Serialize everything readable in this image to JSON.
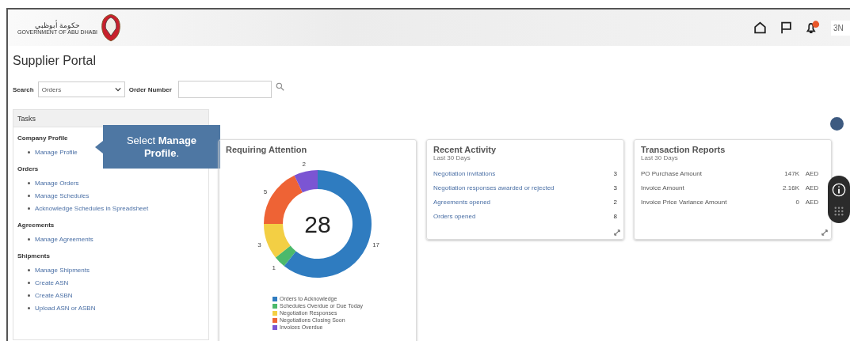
{
  "header": {
    "logo_text_arabic": "حكومة أبوظبي",
    "logo_text": "GOVERNMENT OF ABU DHABI",
    "user_initials": "3N"
  },
  "page_title": "Supplier Portal",
  "search": {
    "label": "Search",
    "value": "Orders",
    "field_label": "Order Number"
  },
  "tasks": {
    "title": "Tasks",
    "groups": [
      {
        "heading": "Company Profile",
        "items": [
          "Manage Profile"
        ]
      },
      {
        "heading": "Orders",
        "items": [
          "Manage Orders",
          "Manage Schedules",
          "Acknowledge Schedules in Spreadsheet"
        ]
      },
      {
        "heading": "Agreements",
        "items": [
          "Manage Agreements"
        ]
      },
      {
        "heading": "Shipments",
        "items": [
          "Manage Shipments",
          "Create ASN",
          "Create ASBN",
          "Upload ASN or ASBN"
        ]
      }
    ]
  },
  "callout": "Select **Manage Profile**.",
  "requiring_attention": {
    "title": "Requiring Attention",
    "total": "28",
    "chart_data": {
      "type": "donut",
      "categories": [
        "Orders to Acknowledge",
        "Schedules Overdue or Due Today",
        "Negotiation Responses",
        "Negotiations Closing Soon",
        "Invoices Overdue"
      ],
      "values": [
        17,
        1,
        3,
        5,
        2
      ],
      "legend": true,
      "colors": [
        "#2f7cc0",
        "#4cb96c",
        "#f3cf44",
        "#ee6335",
        "#7b55d3"
      ],
      "data_labels": true
    }
  },
  "recent_activity": {
    "title": "Recent Activity",
    "subtitle": "Last 30 Days",
    "rows": [
      {
        "label": "Negotiation invitations",
        "value": "3"
      },
      {
        "label": "Negotiation responses awarded or rejected",
        "value": "3"
      },
      {
        "label": "Agreements opened",
        "value": "2"
      },
      {
        "label": "Orders opened",
        "value": "8"
      }
    ]
  },
  "transaction_reports": {
    "title": "Transaction Reports",
    "subtitle": "Last 30 Days",
    "rows": [
      {
        "label": "PO Purchase Amount",
        "value": "147K",
        "currency": "AED"
      },
      {
        "label": "Invoice Amount",
        "value": "2.16K",
        "currency": "AED"
      },
      {
        "label": "Invoice Price Variance Amount",
        "value": "0",
        "currency": "AED"
      }
    ]
  }
}
